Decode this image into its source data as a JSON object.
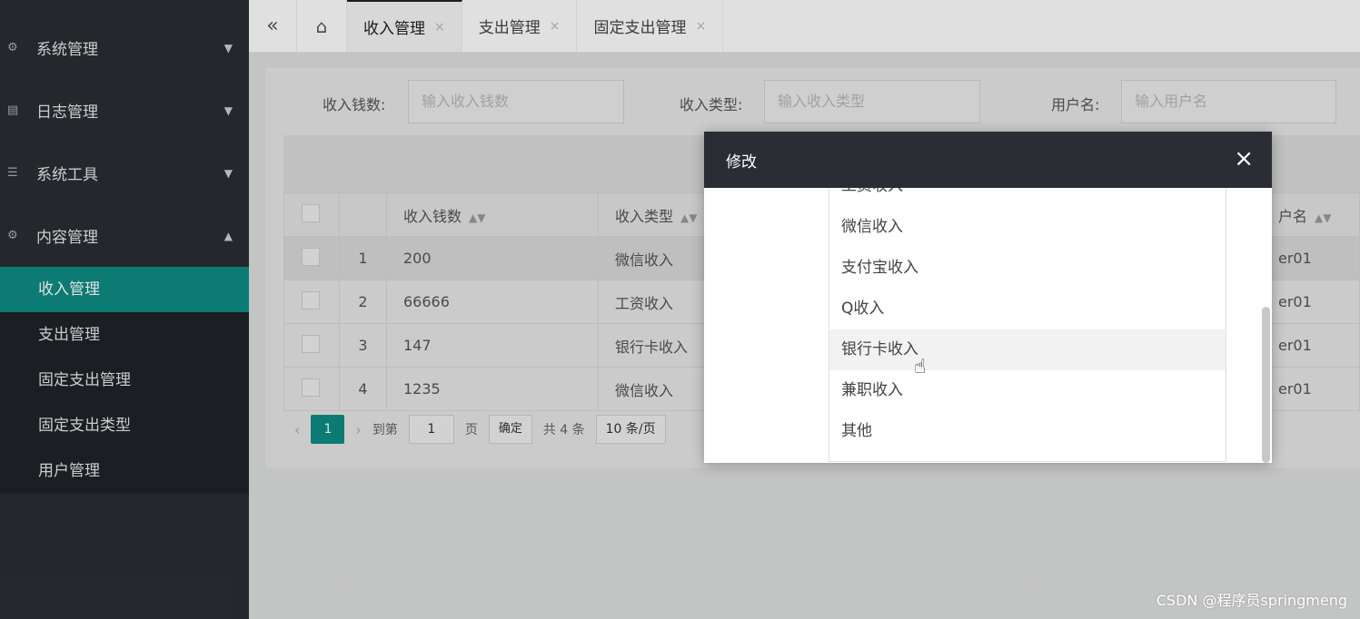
{
  "sidebar": {
    "groups": [
      {
        "label": "系统管理",
        "icon": "gear-icon",
        "chevron": "⌄"
      },
      {
        "label": "日志管理",
        "icon": "document-icon",
        "chevron": "⌄"
      },
      {
        "label": "系统工具",
        "icon": "sliders-icon",
        "chevron": "⌄"
      },
      {
        "label": "内容管理",
        "icon": "gear-icon",
        "chevron": "⌃"
      }
    ],
    "items": [
      "收入管理",
      "支出管理",
      "固定支出管理",
      "固定支出类型",
      "用户管理"
    ],
    "active_color": "#0d8d85"
  },
  "tabs": [
    {
      "label": "收入管理",
      "close": "×"
    },
    {
      "label": "支出管理",
      "close": "×"
    },
    {
      "label": "固定支出管理",
      "close": "×"
    }
  ],
  "search": {
    "amount_label": "收入钱数:",
    "amount_placeholder": "输入收入钱数",
    "type_label": "收入类型:",
    "type_placeholder": "输入收入类型",
    "user_label": "用户名:",
    "user_placeholder": "输入用户名"
  },
  "table": {
    "headers": {
      "amount": "收入钱数",
      "type": "收入类型",
      "user_partial": "户名"
    },
    "rows": [
      {
        "index": "1",
        "amount": "200",
        "type": "微信收入",
        "user": "er01"
      },
      {
        "index": "2",
        "amount": "66666",
        "type": "工资收入",
        "user": "er01"
      },
      {
        "index": "3",
        "amount": "147",
        "type": "银行卡收入",
        "user": "er01"
      },
      {
        "index": "4",
        "amount": "1235",
        "type": "微信收入",
        "user": "er01"
      }
    ]
  },
  "pager": {
    "current": "1",
    "goto_label": "到第",
    "goto_value": "1",
    "page_label": "页",
    "confirm": "确定",
    "total": "共 4 条",
    "page_size": "10 条/页"
  },
  "modal": {
    "title": "修改",
    "close": "×",
    "options": [
      "工资收入",
      "微信收入",
      "支付宝收入",
      "Q收入",
      "银行卡收入",
      "兼职收入",
      "其他"
    ],
    "hovered": "银行卡收入"
  },
  "watermark": "CSDN @程序员springmeng"
}
